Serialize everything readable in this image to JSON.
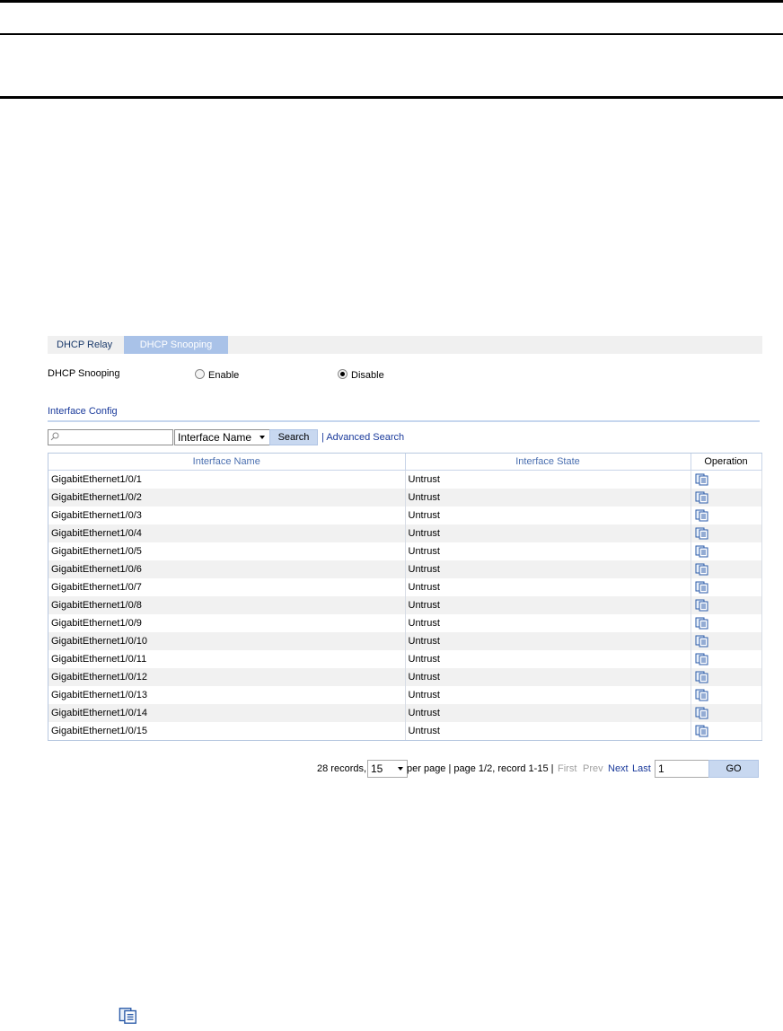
{
  "tabs": [
    {
      "label": "DHCP Relay",
      "active": false
    },
    {
      "label": "DHCP Snooping",
      "active": true
    }
  ],
  "snooping": {
    "label": "DHCP Snooping",
    "options": [
      {
        "label": "Enable",
        "checked": false
      },
      {
        "label": "Disable",
        "checked": true
      }
    ]
  },
  "section_title": "Interface Config",
  "search": {
    "value": "",
    "field": "Interface Name",
    "button": "Search",
    "advanced": "Advanced Search"
  },
  "table": {
    "columns": [
      "Interface Name",
      "Interface State",
      "Operation"
    ],
    "rows": [
      [
        "GigabitEthernet1/0/1",
        "Untrust"
      ],
      [
        "GigabitEthernet1/0/2",
        "Untrust"
      ],
      [
        "GigabitEthernet1/0/3",
        "Untrust"
      ],
      [
        "GigabitEthernet1/0/4",
        "Untrust"
      ],
      [
        "GigabitEthernet1/0/5",
        "Untrust"
      ],
      [
        "GigabitEthernet1/0/6",
        "Untrust"
      ],
      [
        "GigabitEthernet1/0/7",
        "Untrust"
      ],
      [
        "GigabitEthernet1/0/8",
        "Untrust"
      ],
      [
        "GigabitEthernet1/0/9",
        "Untrust"
      ],
      [
        "GigabitEthernet1/0/10",
        "Untrust"
      ],
      [
        "GigabitEthernet1/0/11",
        "Untrust"
      ],
      [
        "GigabitEthernet1/0/12",
        "Untrust"
      ],
      [
        "GigabitEthernet1/0/13",
        "Untrust"
      ],
      [
        "GigabitEthernet1/0/14",
        "Untrust"
      ],
      [
        "GigabitEthernet1/0/15",
        "Untrust"
      ]
    ],
    "operation_icon": "modify-icon"
  },
  "pager": {
    "records": "28 records,",
    "per_page_value": "15",
    "per_page_text": "per page | page 1/2, record 1-15 |",
    "first": "First",
    "prev": "Prev",
    "next": "Next",
    "last": "Last",
    "page_input": "1",
    "go": "GO"
  },
  "colors": {
    "active_tab": "#a9c2e8",
    "link": "#1a3a9b",
    "header_text": "#4a6fb0",
    "button": "#c8d8f0"
  }
}
